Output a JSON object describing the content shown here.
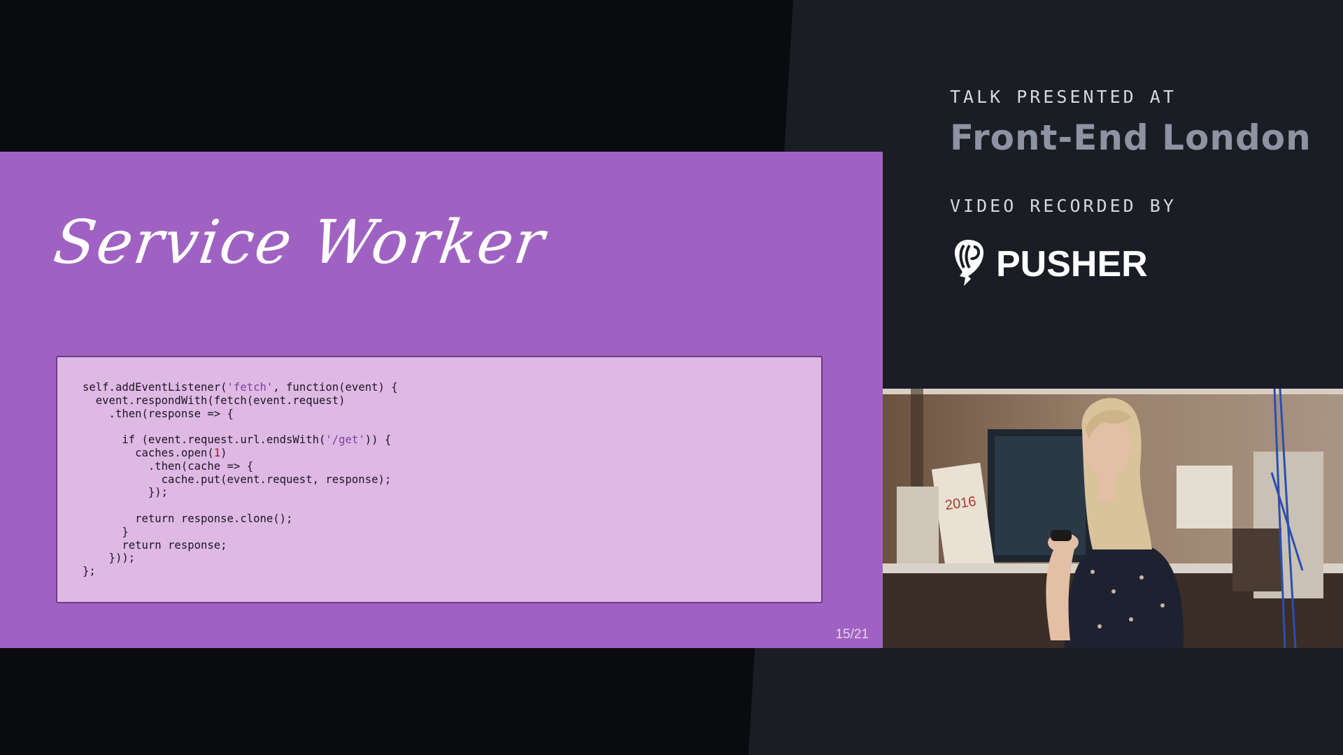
{
  "slide": {
    "title": "Service Worker",
    "page_number": "15/21",
    "code_lines": [
      [
        {
          "t": "self.addEventListener("
        },
        {
          "t": "'fetch'",
          "k": "str"
        },
        {
          "t": ", function(event) {"
        }
      ],
      [
        {
          "t": "  event.respondWith(fetch(event.request)"
        }
      ],
      [
        {
          "t": "    .then(response => {"
        }
      ],
      [
        {
          "t": ""
        }
      ],
      [
        {
          "t": "      if (event.request.url.endsWith("
        },
        {
          "t": "'/get'",
          "k": "str"
        },
        {
          "t": ")) {"
        }
      ],
      [
        {
          "t": "        caches.open("
        },
        {
          "t": "1",
          "k": "num"
        },
        {
          "t": ")"
        }
      ],
      [
        {
          "t": "          .then(cache => {"
        }
      ],
      [
        {
          "t": "            cache.put(event.request, response);"
        }
      ],
      [
        {
          "t": "          });"
        }
      ],
      [
        {
          "t": ""
        }
      ],
      [
        {
          "t": "        return response.clone();"
        }
      ],
      [
        {
          "t": "      }"
        }
      ],
      [
        {
          "t": "      return response;"
        }
      ],
      [
        {
          "t": "    }));"
        }
      ],
      [
        {
          "t": "};"
        }
      ]
    ],
    "colors": {
      "background": "#a062c2",
      "code_bg": "#deb9e4"
    }
  },
  "sidebar": {
    "talk_label": "TALK PRESENTED AT",
    "event_name": "Front-End London",
    "video_label": "VIDEO RECORDED BY",
    "sponsor": "PUSHER",
    "sponsor_icon": "pusher-logo-icon"
  },
  "video": {
    "overlay_text": "2016"
  }
}
